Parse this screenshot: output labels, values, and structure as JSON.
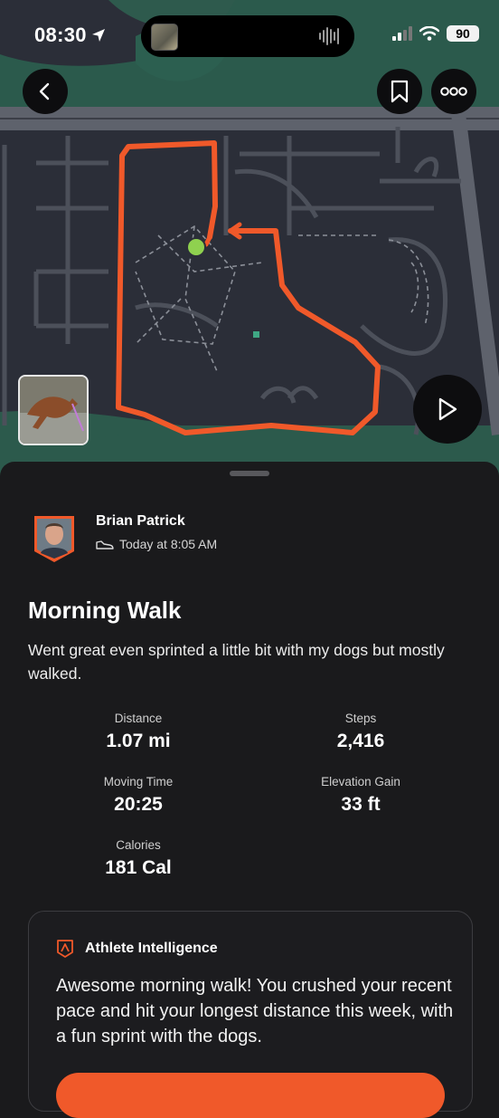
{
  "status_bar": {
    "time": "08:30",
    "battery": "90"
  },
  "icons": {
    "location": "location-arrow-icon",
    "back": "chevron-left-icon",
    "bookmark": "bookmark-icon",
    "more": "more-dots-icon",
    "play": "play-icon",
    "shoe": "shoe-icon",
    "athlete_intelligence": "athlete-intelligence-icon"
  },
  "colors": {
    "accent": "#f0592a",
    "route": "#f0592a",
    "start_marker": "#8fd14f",
    "background": "#1a1a1c"
  },
  "athlete": {
    "name": "Brian Patrick",
    "timestamp": "Today at 8:05 AM"
  },
  "activity": {
    "title": "Morning Walk",
    "description": "Went great even sprinted a little bit with my dogs but mostly walked."
  },
  "stats": {
    "distance": {
      "label": "Distance",
      "value": "1.07 mi"
    },
    "steps": {
      "label": "Steps",
      "value": "2,416"
    },
    "moving_time": {
      "label": "Moving Time",
      "value": "20:25"
    },
    "elevation_gain": {
      "label": "Elevation Gain",
      "value": "33 ft"
    },
    "calories": {
      "label": "Calories",
      "value": "181 Cal"
    }
  },
  "athlete_intelligence": {
    "title": "Athlete Intelligence",
    "text": "Awesome morning walk! You crushed your recent pace and hit your longest distance this week, with a fun sprint with the dogs."
  }
}
